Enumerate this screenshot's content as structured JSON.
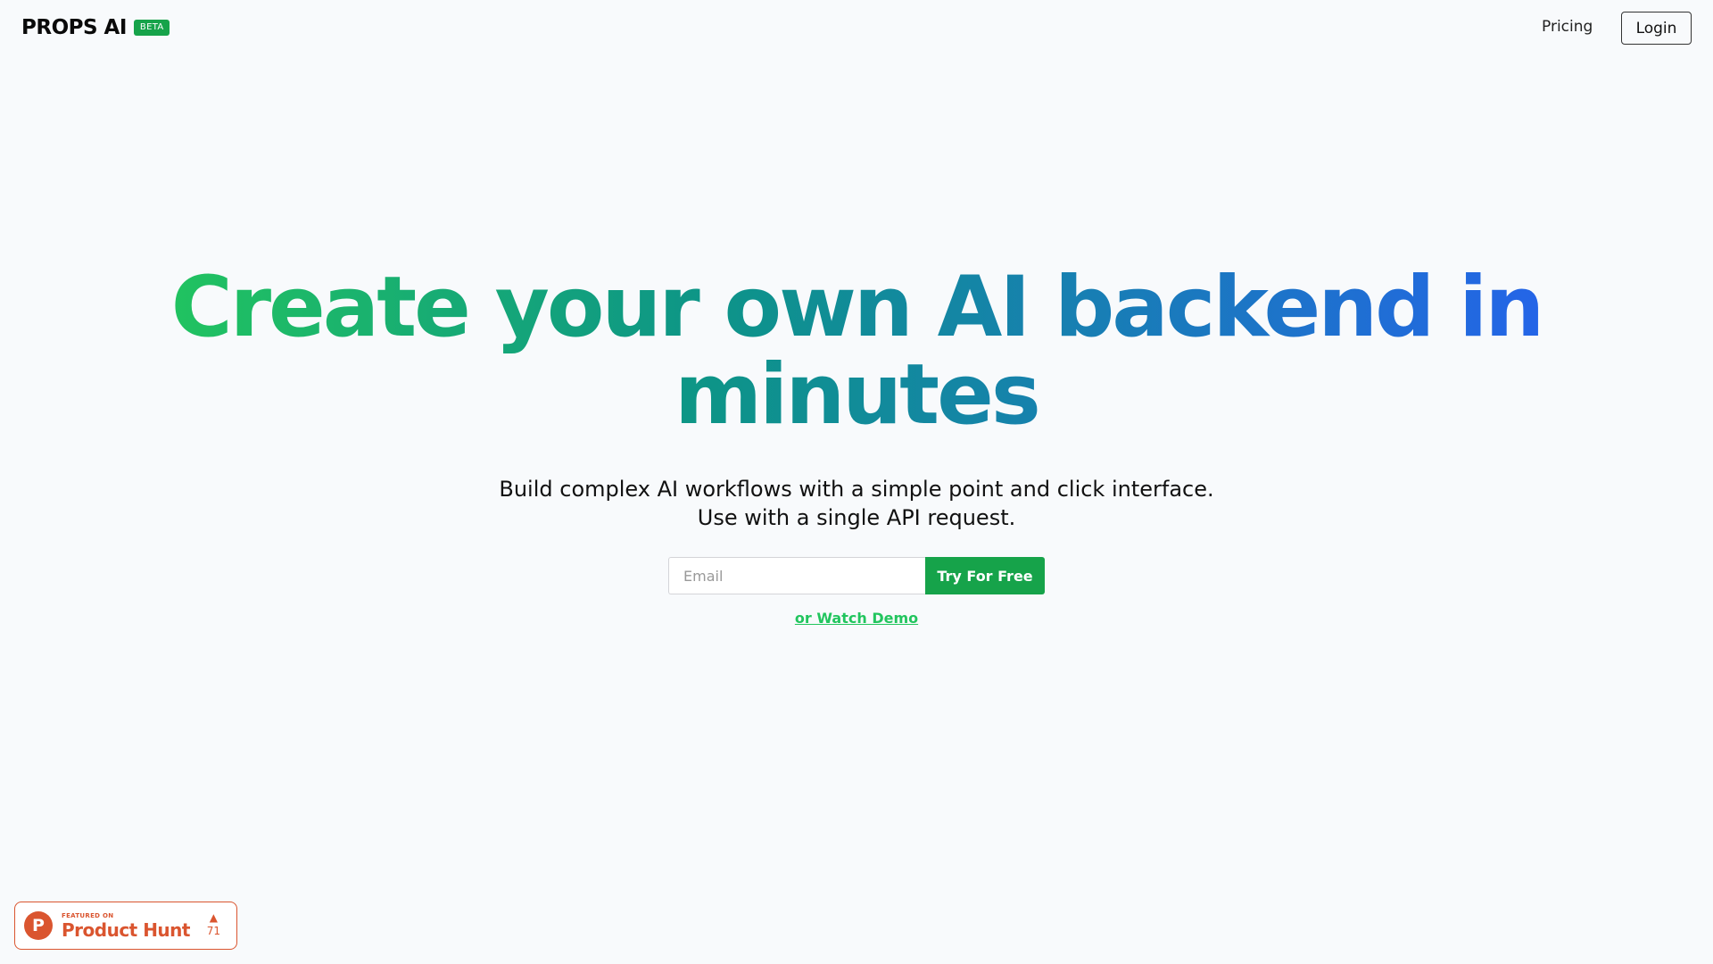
{
  "header": {
    "logo": "PROPS AI",
    "badge": "BETA",
    "nav": {
      "pricing": "Pricing",
      "login": "Login"
    }
  },
  "hero": {
    "headline": "Create your own AI backend in minutes",
    "subtitle_line1": "Build complex AI workflows with a simple point and click interface.",
    "subtitle_line2": "Use with a single API request.",
    "gradient": [
      "#22c55e",
      "#0d9488",
      "#2563eb"
    ]
  },
  "signup": {
    "email_placeholder": "Email",
    "email_value": "",
    "cta": "Try For Free",
    "cta_color": "#16a34a",
    "watch_demo": "or Watch Demo"
  },
  "product_hunt": {
    "icon": "product-hunt-logo",
    "logo_letter": "P",
    "featured": "FEATURED ON",
    "name": "Product Hunt",
    "upvote_icon": "triangle-up",
    "upvotes": "71",
    "color": "#da552f"
  }
}
